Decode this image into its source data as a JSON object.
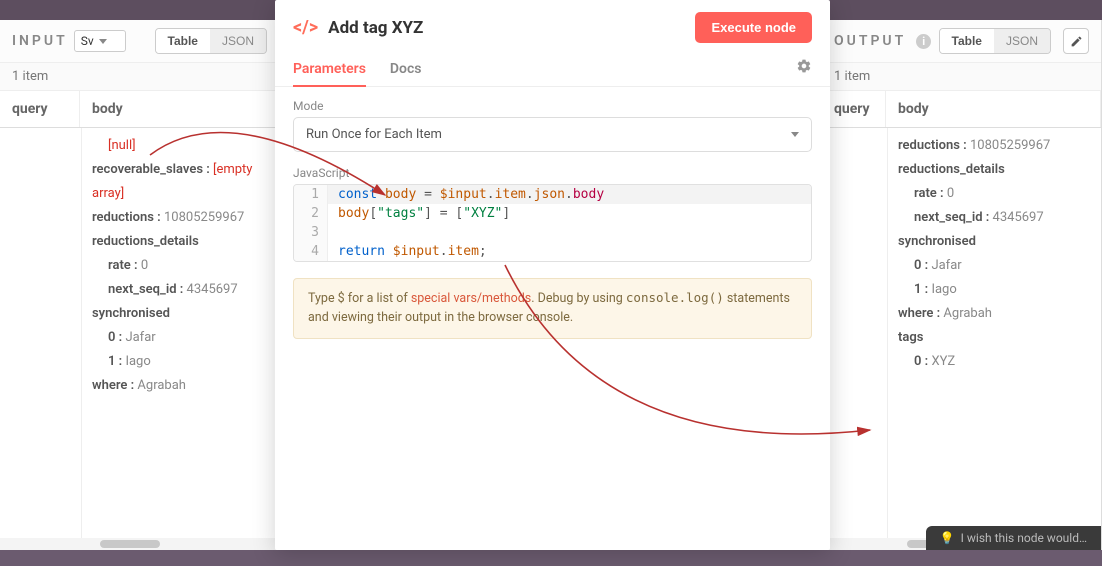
{
  "input_panel": {
    "title": "INPUT",
    "sv_label": "Sv",
    "view_table": "Table",
    "view_json": "JSON",
    "items_count": "1 item",
    "columns": {
      "query": "query",
      "body": "body"
    },
    "rows": {
      "null": "[null]",
      "recoverable_slaves_key": "recoverable_slaves :",
      "recoverable_slaves_val": "[empty array]",
      "reductions_key": "reductions :",
      "reductions_val": "10805259967",
      "reductions_details_key": "reductions_details",
      "rate_key": "rate :",
      "rate_val": "0",
      "next_seq_key": "next_seq_id :",
      "next_seq_val": "4345697",
      "synchronised_key": "synchronised",
      "sync0_key": "0 :",
      "sync0_val": "Jafar",
      "sync1_key": "1 :",
      "sync1_val": "Iago",
      "where_key": "where :",
      "where_val": "Agrabah"
    }
  },
  "modal": {
    "title": "Add tag XYZ",
    "execute": "Execute node",
    "tab_parameters": "Parameters",
    "tab_docs": "Docs",
    "mode_label": "Mode",
    "mode_value": "Run Once for Each Item",
    "js_label": "JavaScript",
    "code": {
      "1_kw": "const",
      "1_var": " body ",
      "1_eq": "= ",
      "1_inp": "$input",
      "1_dot1": ".",
      "1_item": "item",
      "1_dot2": ".",
      "1_json": "json",
      "1_dot3": ".",
      "1_body": "body",
      "2_body": "body",
      "2_br1": "[",
      "2_tags": "\"tags\"",
      "2_br2": "]",
      "2_eq": " = ",
      "2_br3": "[",
      "2_xyz": "\"XYZ\"",
      "2_br4": "]",
      "4_ret": "return ",
      "4_inp": "$input",
      "4_dot": ".",
      "4_item": "item",
      "4_semi": ";"
    },
    "hint_pre": "Type $ for a list of ",
    "hint_accent": "special vars/methods",
    "hint_mid": ". Debug by using ",
    "hint_mono": "console.log()",
    "hint_post": " statements and viewing their output in the browser console."
  },
  "output_panel": {
    "title": "OUTPUT",
    "view_table": "Table",
    "view_json": "JSON",
    "items_count": "1 item",
    "columns": {
      "query": "query",
      "body": "body"
    },
    "rows": {
      "reductions_key": "reductions :",
      "reductions_val": "10805259967",
      "reductions_details_key": "reductions_details",
      "rate_key": "rate :",
      "rate_val": "0",
      "next_seq_key": "next_seq_id :",
      "next_seq_val": "4345697",
      "synchronised_key": "synchronised",
      "sync0_key": "0 :",
      "sync0_val": "Jafar",
      "sync1_key": "1 :",
      "sync1_val": "Iago",
      "where_key": "where :",
      "where_val": "Agrabah",
      "tags_key": "tags",
      "tag0_key": "0 :",
      "tag0_val": "XYZ"
    }
  },
  "feedback": "I wish this node would…"
}
